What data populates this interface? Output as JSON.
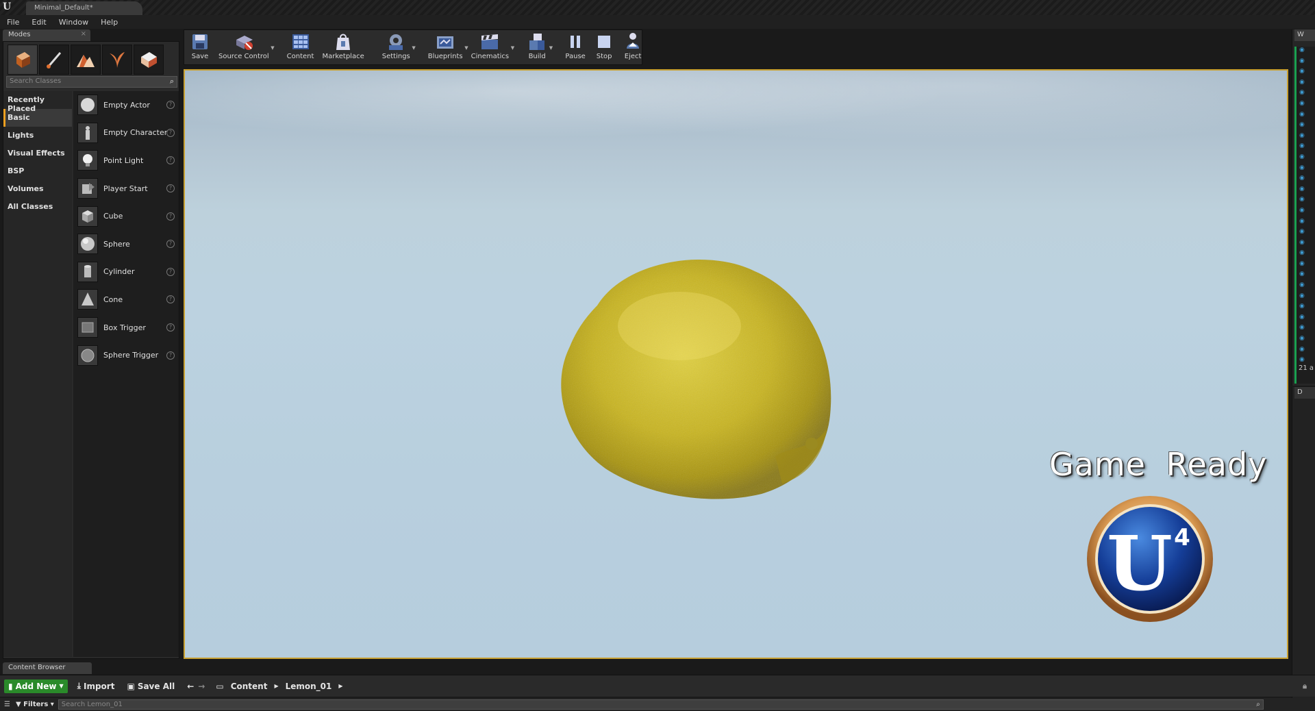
{
  "window": {
    "doc_tab": "Minimal_Default*",
    "logo": "U"
  },
  "menu": [
    "File",
    "Edit",
    "Window",
    "Help"
  ],
  "modes": {
    "tab_label": "Modes",
    "search_placeholder": "Search Classes",
    "categories": [
      "Recently Placed",
      "Basic",
      "Lights",
      "Visual Effects",
      "BSP",
      "Volumes",
      "All Classes"
    ],
    "active_category": "Basic",
    "items": [
      "Empty Actor",
      "Empty Character",
      "Point Light",
      "Player Start",
      "Cube",
      "Sphere",
      "Cylinder",
      "Cone",
      "Box Trigger",
      "Sphere Trigger"
    ]
  },
  "toolbar": {
    "save": "Save",
    "source_control": "Source Control",
    "content": "Content",
    "marketplace": "Marketplace",
    "settings": "Settings",
    "blueprints": "Blueprints",
    "cinematics": "Cinematics",
    "build": "Build",
    "pause": "Pause",
    "stop": "Stop",
    "eject": "Eject"
  },
  "viewport": {
    "overlay_text": "Game Ready",
    "logo_text": "U",
    "logo_superscript": "4",
    "sky_color": "#b8cfde",
    "lemon_color": "#d8c828"
  },
  "right_panel": {
    "tab": "W",
    "count": "21 a",
    "lower_tab": "D"
  },
  "content_browser": {
    "tab_label": "Content Browser",
    "add_new": "Add New",
    "import": "Import",
    "save_all": "Save All",
    "breadcrumb": [
      "Content",
      "Lemon_01"
    ],
    "filters": "Filters",
    "search_placeholder": "Search Lemon_01"
  },
  "colors": {
    "accent": "#c8a030",
    "add_new_green": "#2a8a2a",
    "active_category": "#f0a020"
  }
}
